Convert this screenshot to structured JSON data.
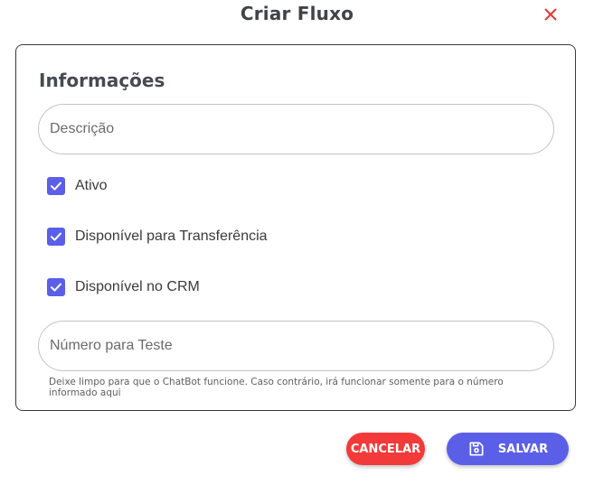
{
  "dialog": {
    "title": "Criar Fluxo",
    "close_icon": "close-icon"
  },
  "section": {
    "title": "Informações"
  },
  "description_field": {
    "placeholder": "Descrição",
    "value": ""
  },
  "checkboxes": [
    {
      "label": "Ativo",
      "checked": true
    },
    {
      "label": "Disponível para Transferência",
      "checked": true
    },
    {
      "label": "Disponível no CRM",
      "checked": true
    }
  ],
  "test_number_field": {
    "placeholder": "Número para Teste",
    "value": "",
    "helper_text": "Deixe limpo para que o ChatBot funcione. Caso contrário, irá funcionar somente para o número informado aqui"
  },
  "actions": {
    "cancel_label": "CANCELAR",
    "save_label": "SALVAR",
    "save_icon": "save-icon"
  },
  "colors": {
    "primary": "#5b5fe8",
    "danger": "#f23a3a",
    "close_icon": "#e53935"
  }
}
